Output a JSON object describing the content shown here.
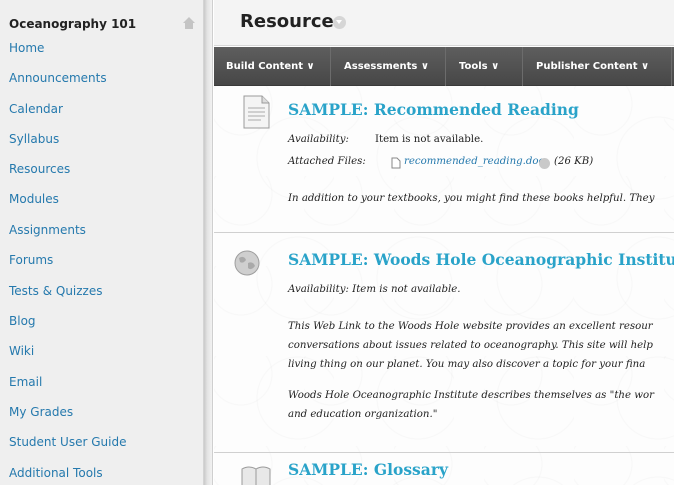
{
  "course": {
    "title": "Oceanography 101"
  },
  "nav": [
    "Home",
    "Announcements",
    "Calendar",
    "Syllabus",
    "Resources",
    "Modules",
    "Assignments",
    "Forums",
    "Tests & Quizzes",
    "Blog",
    "Wiki",
    "Email",
    "My Grades",
    "Student User Guide",
    "Additional Tools"
  ],
  "page": {
    "title": "Resources"
  },
  "action_bar": [
    {
      "label": "Build Content ∨"
    },
    {
      "label": "Assessments ∨"
    },
    {
      "label": "Tools ∨"
    },
    {
      "label": "Publisher Content ∨"
    }
  ],
  "items": [
    {
      "title": "SAMPLE: Recommended Reading",
      "availability_label": "Availability:",
      "availability_value": "Item is not available.",
      "attached_label": "Attached Files:",
      "file_name": "recommended_reading.doc",
      "file_size": "(26 KB)",
      "body": "In addition to your textbooks, you might find these books helpful. They"
    },
    {
      "title": "SAMPLE: Woods Hole Oceanographic Institut",
      "availability": "Availability:  Item is not available.",
      "body_lines": [
        "This Web Link to the Woods Hole website provides an excellent resour",
        "conversations about issues related to oceanography. This site will help",
        "living thing on our planet. You may also discover a topic for your fina"
      ],
      "body2_lines": [
        "Woods Hole Oceanographic Institute describes themselves as \"the wor",
        "and education organization.\""
      ]
    },
    {
      "title": "SAMPLE: Glossary"
    }
  ],
  "colors": {
    "nav_link": "#2579ad",
    "item_title": "#2aa3c9",
    "action_bar": "#525252"
  }
}
